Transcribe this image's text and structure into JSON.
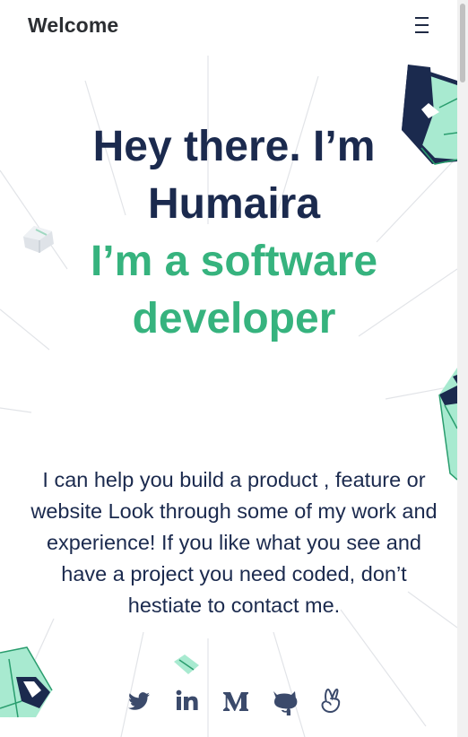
{
  "header": {
    "brand": "Welcome",
    "menu_icon": "hamburger-menu-icon"
  },
  "hero": {
    "line1": "Hey there. I’m",
    "line2": "Humaira",
    "line3": "I’m a software",
    "line4": "developer"
  },
  "intro": {
    "text": "I can help you build a product , feature or website Look through some of my work and experience! If you like what you see and have a project you need coded, don’t hestiate to contact me."
  },
  "social": [
    {
      "icon": "twitter-icon"
    },
    {
      "icon": "linkedin-icon"
    },
    {
      "icon": "medium-icon"
    },
    {
      "icon": "github-icon"
    },
    {
      "icon": "angellist-icon"
    }
  ],
  "colors": {
    "navy": "#1b2a4e",
    "green": "#36b37e",
    "brand_text": "#2b2e32",
    "icon": "#3b4a6b"
  }
}
